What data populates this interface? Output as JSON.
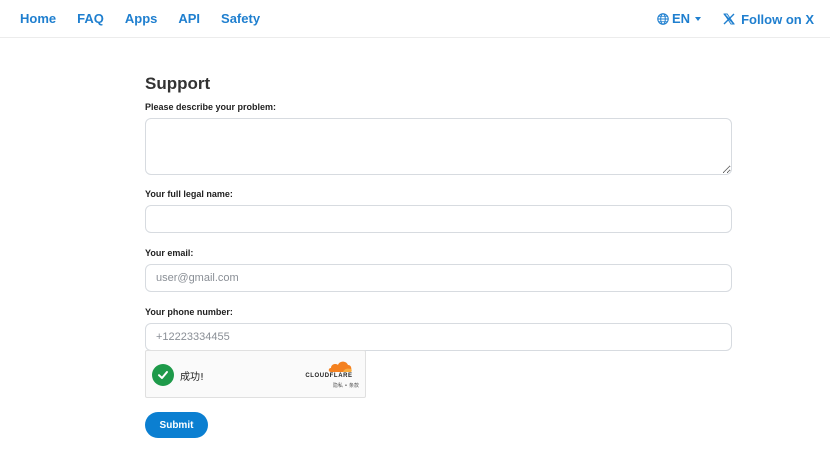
{
  "nav": {
    "items": [
      {
        "label": "Home"
      },
      {
        "label": "FAQ"
      },
      {
        "label": "Apps"
      },
      {
        "label": "API"
      },
      {
        "label": "Safety"
      }
    ],
    "language": "EN",
    "follow_label": "Follow on X"
  },
  "form": {
    "title": "Support",
    "problem_label": "Please describe your problem:",
    "problem_value": "",
    "name_label": "Your full legal name:",
    "name_value": "",
    "email_label": "Your email:",
    "email_placeholder": "user@gmail.com",
    "phone_label": "Your phone number:",
    "phone_placeholder": "+12223334455",
    "submit_label": "Submit"
  },
  "captcha": {
    "status_text": "成功!",
    "brand": "CLOUDFLARE",
    "links": "隐私 • 条款",
    "check_color": "#1e9a4a",
    "brand_color": "#f48120"
  },
  "colors": {
    "accent": "#1f7fcf",
    "button": "#0b7fd1"
  }
}
